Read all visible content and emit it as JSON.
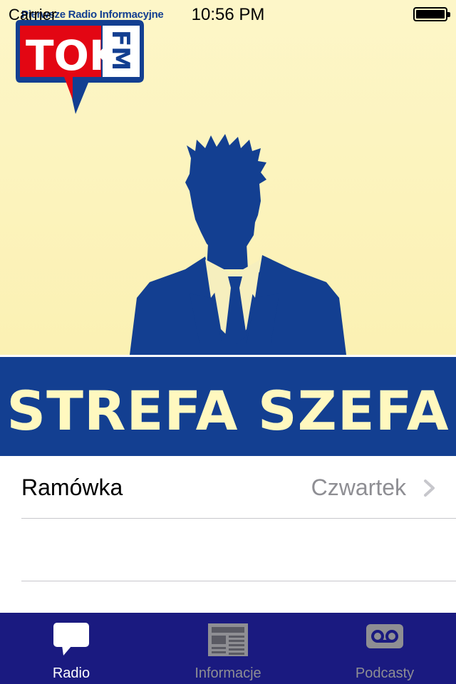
{
  "status_bar": {
    "carrier": "Carrier",
    "time": "10:56 PM"
  },
  "logo": {
    "main_text": "TOK",
    "side_text": "FM",
    "tagline": "Pierwsze Radio Informacyjne"
  },
  "banner": {
    "title": "STREFA SZEFA"
  },
  "list": {
    "rows": [
      {
        "label": "Ramówka",
        "value": "Czwartek"
      },
      {
        "label": "",
        "value": ""
      }
    ]
  },
  "tabbar": {
    "items": [
      {
        "label": "Radio",
        "icon": "speech-bubble-icon",
        "active": true
      },
      {
        "label": "Informacje",
        "icon": "newspaper-icon",
        "active": false
      },
      {
        "label": "Podcasty",
        "icon": "voicemail-icon",
        "active": false
      }
    ]
  },
  "colors": {
    "brand_blue": "#133f91",
    "brand_red": "#e30613",
    "banner_text": "#fff8bf",
    "tabbar_bg": "#1a1a80",
    "hero_bg": "#fdf6c8"
  }
}
